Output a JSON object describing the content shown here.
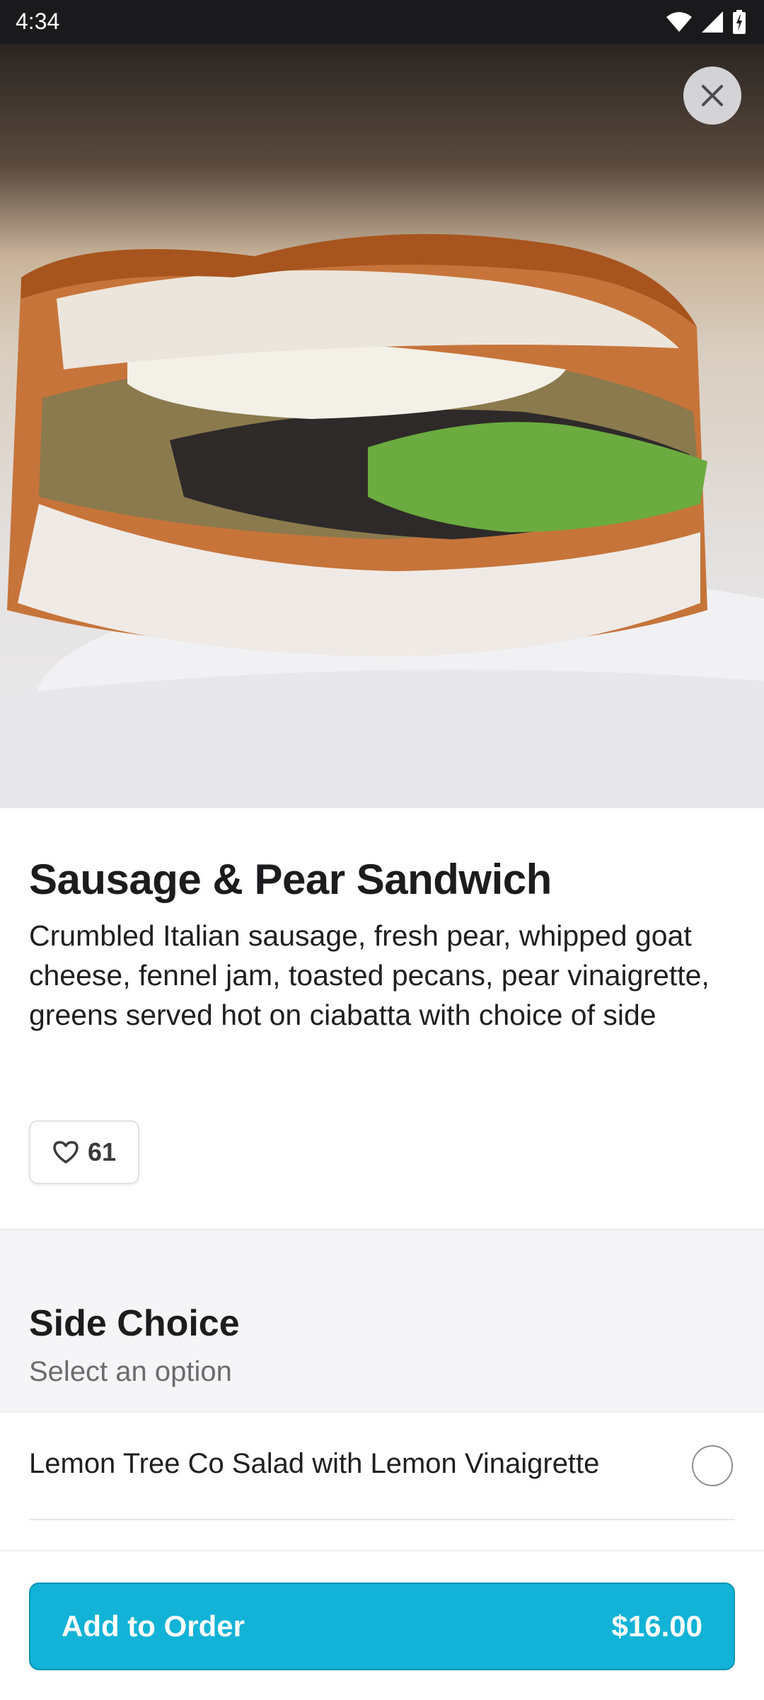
{
  "status_bar": {
    "time": "4:34"
  },
  "item": {
    "title": "Sausage & Pear Sandwich",
    "description": "Crumbled Italian sausage, fresh pear, whipped goat cheese, fennel jam, toasted pecans, pear vinaigrette, greens served hot on ciabatta with choice of side",
    "likes": "61"
  },
  "side_choice": {
    "title": "Side Choice",
    "subtitle": "Select an option",
    "options": [
      {
        "label": "Lemon Tree Co Salad with Lemon Vinaigrette",
        "selected": false
      }
    ]
  },
  "cart": {
    "button_label": "Add to Order",
    "price": "$16.00"
  },
  "colors": {
    "accent": "#12b3d6",
    "status_bar": "#1a1a1c"
  },
  "icons": {
    "close": "close-icon",
    "like": "heart-icon",
    "wifi": "wifi-icon",
    "signal": "signal-icon",
    "battery": "battery-icon"
  }
}
